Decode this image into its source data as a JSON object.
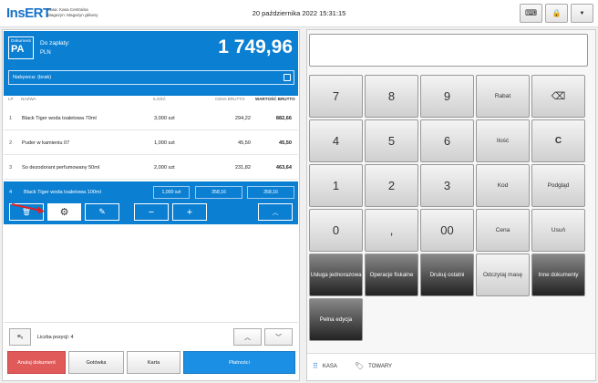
{
  "header": {
    "logo": "InsERT",
    "kasa_line1": "Kasa: Kasa Centralna",
    "kasa_line2": "Magazyn: Magazyn główny",
    "datetime": "20 października 2022 15:31:15",
    "keyboard_icon": "keyboard-icon",
    "lock_icon": "lock-icon",
    "menu_icon": "chevron-down-icon"
  },
  "document": {
    "label": "Dokument",
    "type": "PA",
    "to_pay_label": "Do zapłaty:",
    "currency": "PLN",
    "total": "1 749,96",
    "buyer": "Nabywca: (brak)"
  },
  "table": {
    "columns": {
      "lp": "LP",
      "name": "NAZWA",
      "qty": "ILOŚĆ",
      "price": "CENA BRUTTO",
      "value": "WARTOŚĆ BRUTTO"
    },
    "rows": [
      {
        "lp": "1",
        "name": "Black Tiger woda toaletowa 70ml",
        "qty": "3,000 szt",
        "price": "294,22",
        "value": "882,66"
      },
      {
        "lp": "2",
        "name": "Puder w kamieniu 07",
        "qty": "1,000 szt",
        "price": "45,50",
        "value": "45,50"
      },
      {
        "lp": "3",
        "name": "So dezodorant perfumowany 50ml",
        "qty": "2,000 szt",
        "price": "231,82",
        "value": "463,64"
      }
    ],
    "selected": {
      "lp": "4",
      "name": "Black Tiger woda toaletowa 100ml",
      "qty": "1,000 szt",
      "price": "358,16",
      "value": "358,16"
    }
  },
  "footer": {
    "count_label": "Liczba pozycji: 4",
    "cancel": "Anuluj dokument",
    "cash": "Gotówka",
    "card": "Karta",
    "payments": "Płatności"
  },
  "keypad": {
    "row1": [
      "7",
      "8",
      "9",
      "Rabat"
    ],
    "row2": [
      "4",
      "5",
      "6",
      "Ilość",
      "C"
    ],
    "row3": [
      "1",
      "2",
      "3",
      "Kod",
      "Podgląd"
    ],
    "row4": [
      "0",
      ",",
      "00",
      "Cena",
      "Usuń"
    ],
    "row5": [
      "Usługa jednorazowa",
      "Operacje fiskalne",
      "Drukuj ostatni",
      "Odczytaj masę",
      "Inne dokumenty"
    ],
    "row6": [
      "Pełna edycja"
    ]
  },
  "tabs": {
    "kasa": "KASA",
    "towary": "TOWARY"
  },
  "colors": {
    "accent": "#0b7fd2",
    "cancel": "#e05a5a",
    "pay": "#1a8fe3"
  }
}
